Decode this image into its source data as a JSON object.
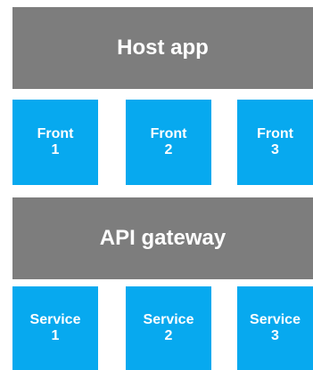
{
  "host": {
    "label": "Host app"
  },
  "gateway": {
    "label": "API gateway"
  },
  "fronts": [
    {
      "name": "Front",
      "num": "1"
    },
    {
      "name": "Front",
      "num": "2"
    },
    {
      "name": "Front",
      "num": "3"
    }
  ],
  "services": [
    {
      "name": "Service",
      "num": "1"
    },
    {
      "name": "Service",
      "num": "2"
    },
    {
      "name": "Service",
      "num": "3"
    }
  ],
  "colors": {
    "band": "#7d7d7d",
    "tile": "#07a9ef",
    "text": "#ffffff"
  }
}
